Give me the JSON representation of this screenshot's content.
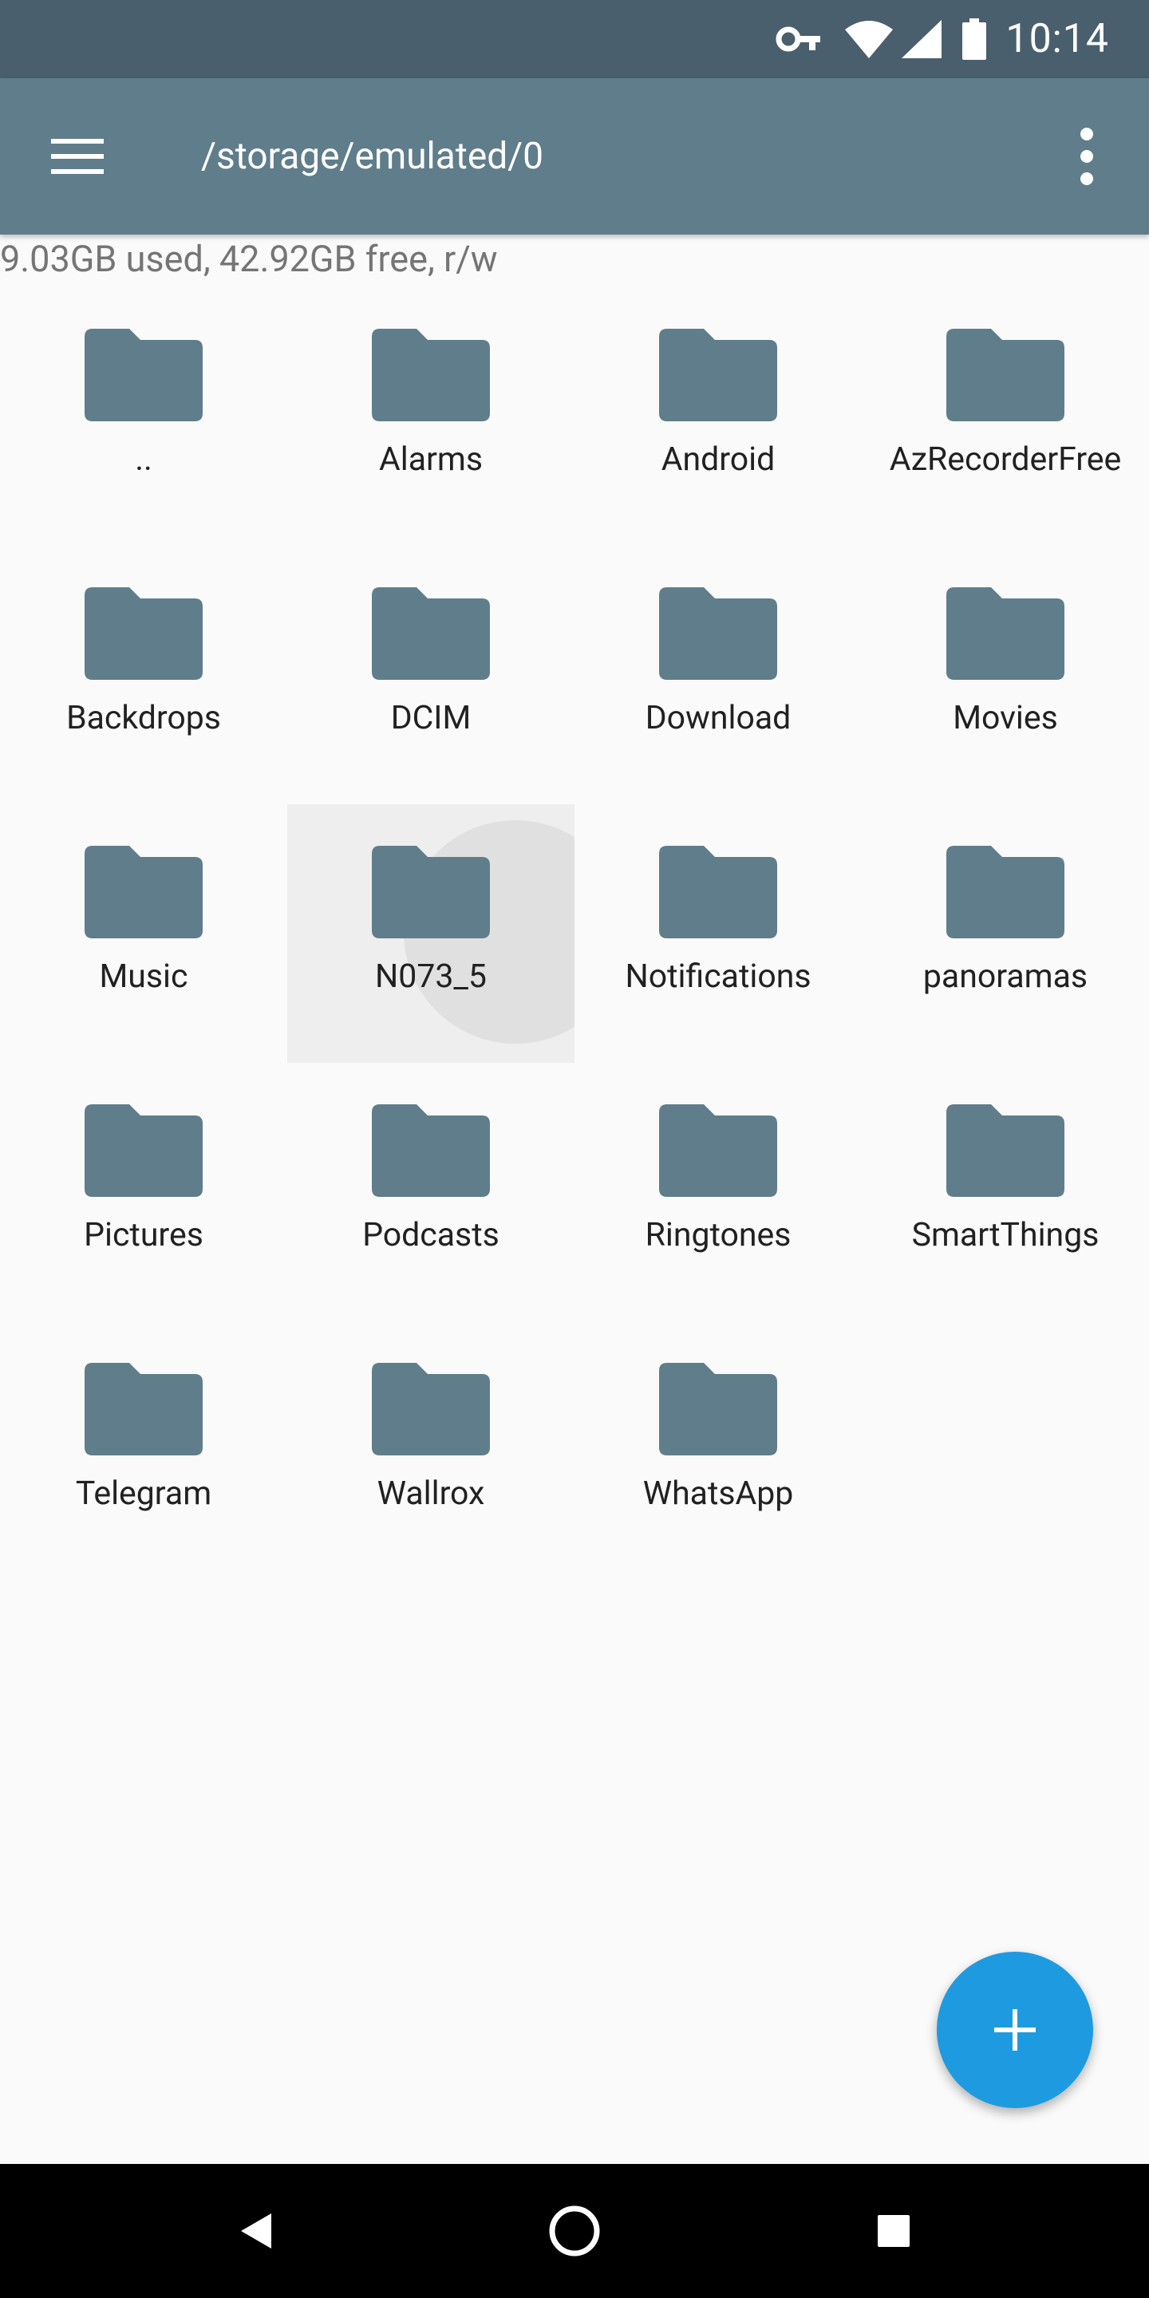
{
  "status_bar": {
    "time": "10:14",
    "icons": [
      "vpn-key-icon",
      "wifi-icon",
      "cell-signal-icon",
      "battery-icon"
    ]
  },
  "app_bar": {
    "path": "/storage/emulated/0",
    "menu_icon": "hamburger-menu-icon",
    "overflow_icon": "more-vert-icon"
  },
  "storage_info": "9.03GB used, 42.92GB free, r/w",
  "folders": [
    {
      "name": ".."
    },
    {
      "name": "Alarms"
    },
    {
      "name": "Android"
    },
    {
      "name": "AzRecorderFree"
    },
    {
      "name": "Backdrops"
    },
    {
      "name": "DCIM"
    },
    {
      "name": "Download"
    },
    {
      "name": "Movies"
    },
    {
      "name": "Music"
    },
    {
      "name": "N073_5",
      "pressed": true
    },
    {
      "name": "Notifications"
    },
    {
      "name": "panoramas"
    },
    {
      "name": "Pictures"
    },
    {
      "name": "Podcasts"
    },
    {
      "name": "Ringtones"
    },
    {
      "name": "SmartThings"
    },
    {
      "name": "Telegram"
    },
    {
      "name": "Wallrox"
    },
    {
      "name": "WhatsApp"
    }
  ],
  "fab": {
    "icon": "plus-icon"
  },
  "nav_bar": {
    "buttons": [
      "back-icon",
      "home-icon",
      "recents-icon"
    ]
  },
  "colors": {
    "app_bar": "#607D8B",
    "status_bar": "#4A5F6D",
    "folder": "#607D8B",
    "fab": "#1E9BE0",
    "background": "#FAFAFA"
  }
}
